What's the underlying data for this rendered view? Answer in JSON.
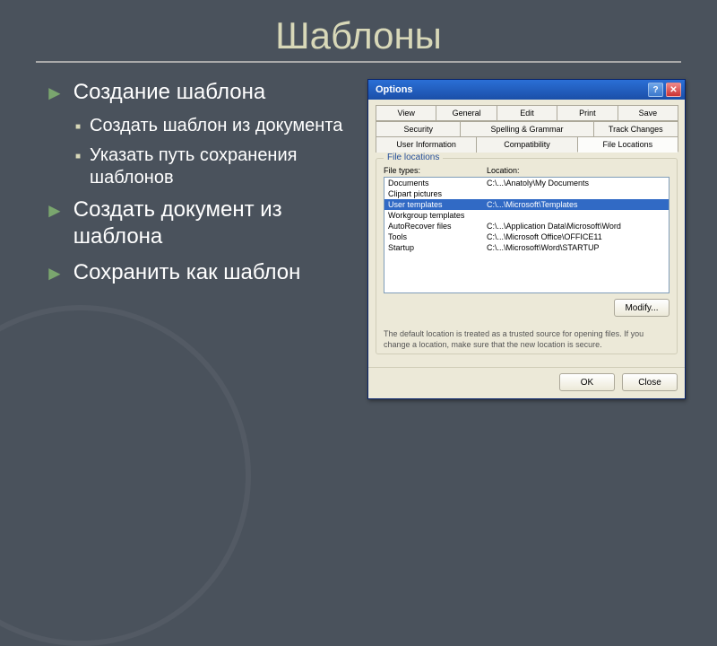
{
  "slide": {
    "title": "Шаблоны",
    "bullets_l1": {
      "b0": "Создание шаблона",
      "b1": "Создать документ из шаблона",
      "b2": "Сохранить как шаблон"
    },
    "bullets_l2": {
      "s0": "Создать шаблон из документа",
      "s1": "Указать путь сохранения шаблонов"
    }
  },
  "dialog": {
    "title": "Options",
    "help_btn": "?",
    "close_btn": "✕",
    "tabs_row1": {
      "t0": "View",
      "t1": "General",
      "t2": "Edit",
      "t3": "Print",
      "t4": "Save"
    },
    "tabs_row2": {
      "t0": "Security",
      "t1": "Spelling & Grammar",
      "t2": "Track Changes"
    },
    "tabs_row3": {
      "t0": "User Information",
      "t1": "Compatibility",
      "t2": "File Locations"
    },
    "group_label": "File locations",
    "headers": {
      "types": "File types:",
      "location": "Location:"
    },
    "rows": {
      "r0": {
        "type": "Documents",
        "loc": "C:\\...\\Anatoly\\My Documents"
      },
      "r1": {
        "type": "Clipart pictures",
        "loc": ""
      },
      "r2": {
        "type": "User templates",
        "loc": "C:\\...\\Microsoft\\Templates"
      },
      "r3": {
        "type": "Workgroup templates",
        "loc": ""
      },
      "r4": {
        "type": "AutoRecover files",
        "loc": "C:\\...\\Application Data\\Microsoft\\Word"
      },
      "r5": {
        "type": "Tools",
        "loc": "C:\\...\\Microsoft Office\\OFFICE11"
      },
      "r6": {
        "type": "Startup",
        "loc": "C:\\...\\Microsoft\\Word\\STARTUP"
      }
    },
    "modify_btn": "Modify...",
    "help_text": "The default location is treated as a trusted source for opening files. If you change a location, make sure that the new location is secure.",
    "ok_btn": "OK",
    "close_footer_btn": "Close"
  }
}
